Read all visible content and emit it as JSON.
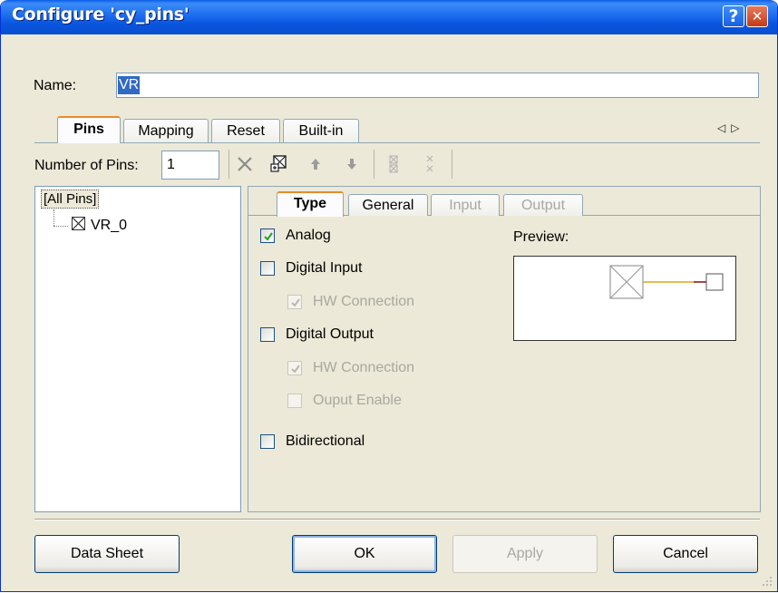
{
  "window": {
    "title": "Configure 'cy_pins'",
    "help_label": "?",
    "close_label": "✕"
  },
  "name": {
    "label": "Name:",
    "value": "VR"
  },
  "tabs": [
    {
      "label": "Pins",
      "active": true
    },
    {
      "label": "Mapping"
    },
    {
      "label": "Reset"
    },
    {
      "label": "Built-in"
    }
  ],
  "tab_scroll": {
    "left": "◁",
    "right": "▷"
  },
  "toolbar": {
    "pins_label": "Number of Pins:",
    "pins_value": "1",
    "icons": [
      "delete-icon",
      "add-pin-icon",
      "move-up-icon",
      "move-down-icon",
      "ungroup-icon",
      "group-icon"
    ]
  },
  "tree": {
    "root": "[All Pins]",
    "children": [
      "VR_0"
    ]
  },
  "inner_tabs": [
    {
      "label": "Type",
      "active": true
    },
    {
      "label": "General"
    },
    {
      "label": "Input",
      "disabled": true
    },
    {
      "label": "Output",
      "disabled": true
    }
  ],
  "type_options": {
    "analog": {
      "label": "Analog",
      "checked": true
    },
    "digital_input": {
      "label": "Digital Input",
      "checked": false
    },
    "di_hw_connection": {
      "label": "HW Connection",
      "checked": true,
      "disabled": true
    },
    "digital_output": {
      "label": "Digital Output",
      "checked": false
    },
    "do_hw_connection": {
      "label": "HW Connection",
      "checked": true,
      "disabled": true
    },
    "output_enable": {
      "label": "Ouput Enable",
      "checked": false,
      "disabled": true
    },
    "bidirectional": {
      "label": "Bidirectional",
      "checked": false
    }
  },
  "preview": {
    "label": "Preview:",
    "wire_color": "#e8a317",
    "tip_color": "#8b1a1a"
  },
  "buttons": {
    "data_sheet": "Data Sheet",
    "ok": "OK",
    "apply": "Apply",
    "cancel": "Cancel"
  },
  "colors": {
    "title_bar": "#0a5ee6",
    "selection": "#316ac5",
    "tab_accent": "#e68b2c"
  }
}
